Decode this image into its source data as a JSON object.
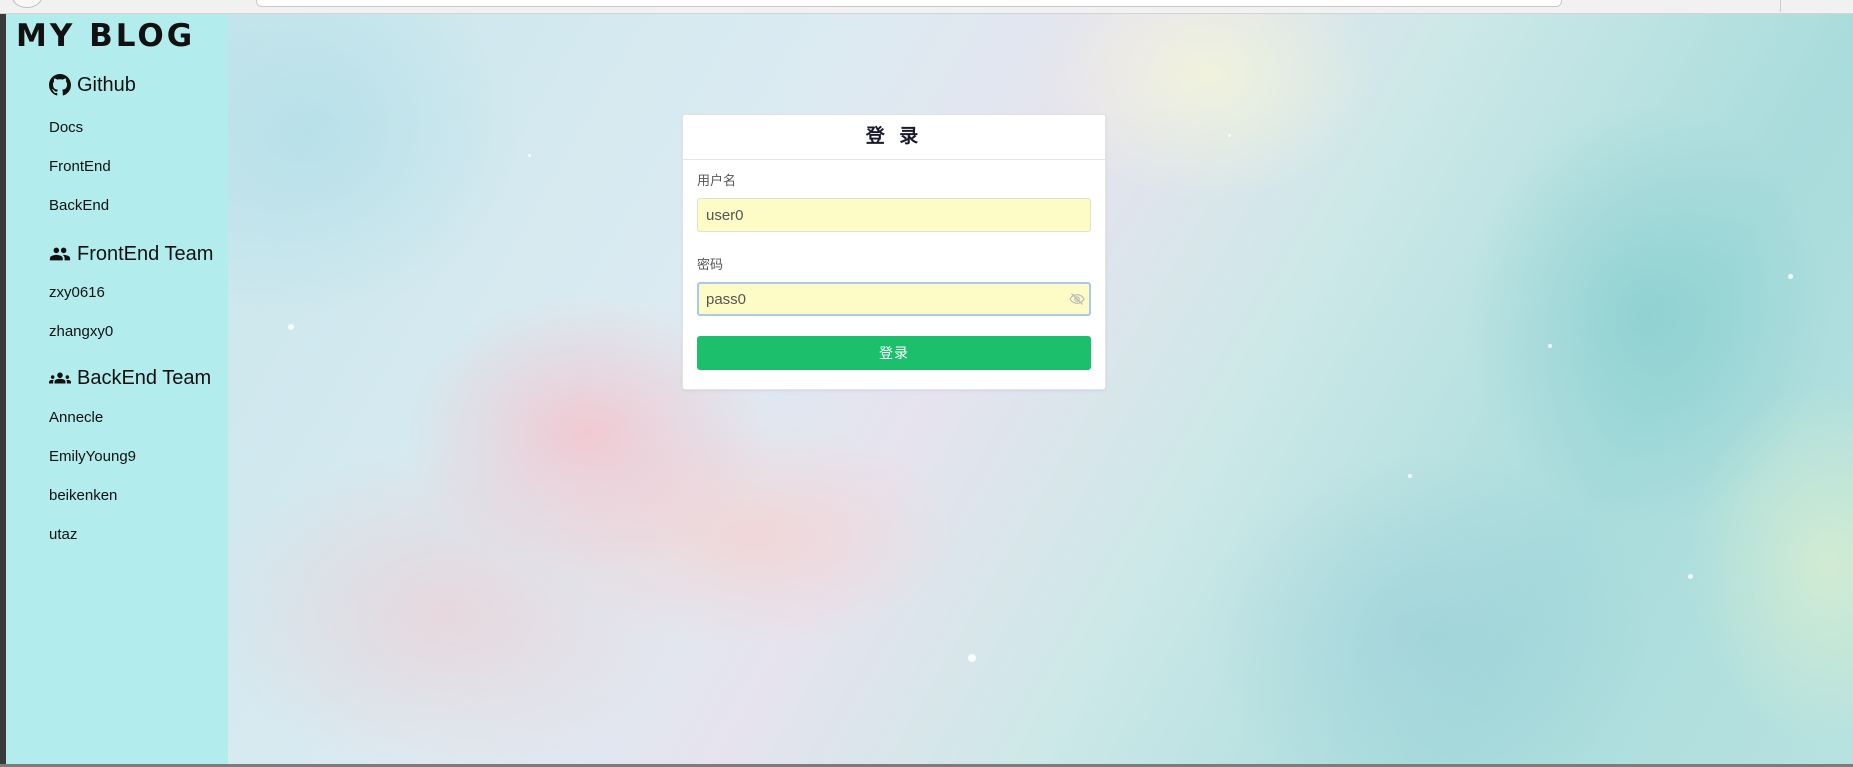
{
  "sidebar": {
    "brand": "MY BLOG",
    "sections": [
      {
        "title": "Github",
        "icon": "github-icon",
        "links": [
          "Docs",
          "FrontEnd",
          "BackEnd"
        ]
      },
      {
        "title": "FrontEnd Team",
        "icon": "people-icon",
        "links": [
          "zxy0616",
          "zhangxy0"
        ]
      },
      {
        "title": "BackEnd Team",
        "icon": "group-icon",
        "links": [
          "Annecle",
          "EmilyYoung9",
          "beikenken",
          "utaz"
        ]
      }
    ]
  },
  "login": {
    "title": "登 录",
    "username_label": "用户名",
    "username_value": "user0",
    "password_label": "密码",
    "password_value": "pass0",
    "submit_label": "登录"
  },
  "colors": {
    "sidebar_bg": "#b3ecec",
    "submit_bg": "#1cbf6c",
    "input_bg": "#fdfbc6"
  }
}
